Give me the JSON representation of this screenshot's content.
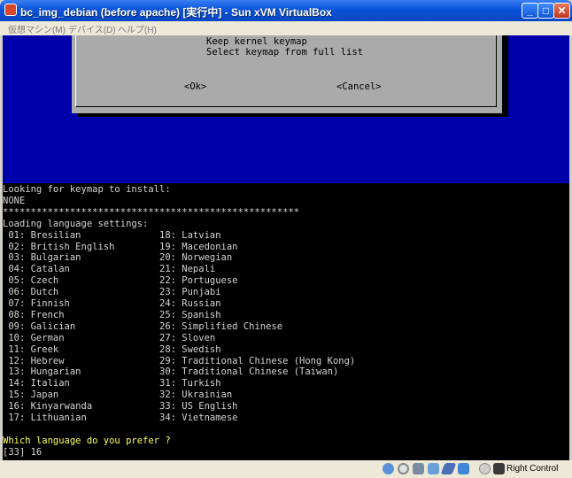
{
  "window": {
    "title": "bc_img_debian (before apache) [実行中] - Sun xVM VirtualBox"
  },
  "menu": [
    "仮想マシン(M)",
    "デバイス(D)",
    "ヘルプ(H)"
  ],
  "dialog": {
    "options": [
      "Keep kernel keymap",
      "Select keymap from full list"
    ],
    "ok_label": "<Ok>",
    "cancel_label": "<Cancel>"
  },
  "terminal": {
    "lines": [
      "Looking for keymap to install:",
      "NONE",
      "*****************************************************",
      "Loading language settings:",
      " 01: Bresilian              18: Latvian",
      " 02: British English        19: Macedonian",
      " 03: Bulgarian              20: Norwegian",
      " 04: Catalan                21: Nepali",
      " 05: Czech                  22: Portuguese",
      " 06: Dutch                  23: Punjabi",
      " 07: Finnish                24: Russian",
      " 08: French                 25: Spanish",
      " 09: Galician               26: Simplified Chinese",
      " 10: German                 27: Sloven",
      " 11: Greek                  28: Swedish",
      " 12: Hebrew                 29: Traditional Chinese (Hong Kong)",
      " 13: Hungarian              30: Traditional Chinese (Taiwan)",
      " 14: Italian                31: Turkish",
      " 15: Japan                  32: Ukrainian",
      " 16: Kinyarwanda            33: US English",
      " 17: Lithuanian             34: Vietnamese"
    ],
    "prompt": "Which language do you prefer ?",
    "input": "[33] 16"
  },
  "statusbar": {
    "icons": [
      "hard-disk-icon",
      "cd-icon",
      "floppy-icon",
      "network-icon",
      "usb-icon",
      "shared-folder-icon",
      "mouse-integration-icon",
      "host-key-arrow-icon"
    ],
    "host_key_label": "Right Control"
  }
}
